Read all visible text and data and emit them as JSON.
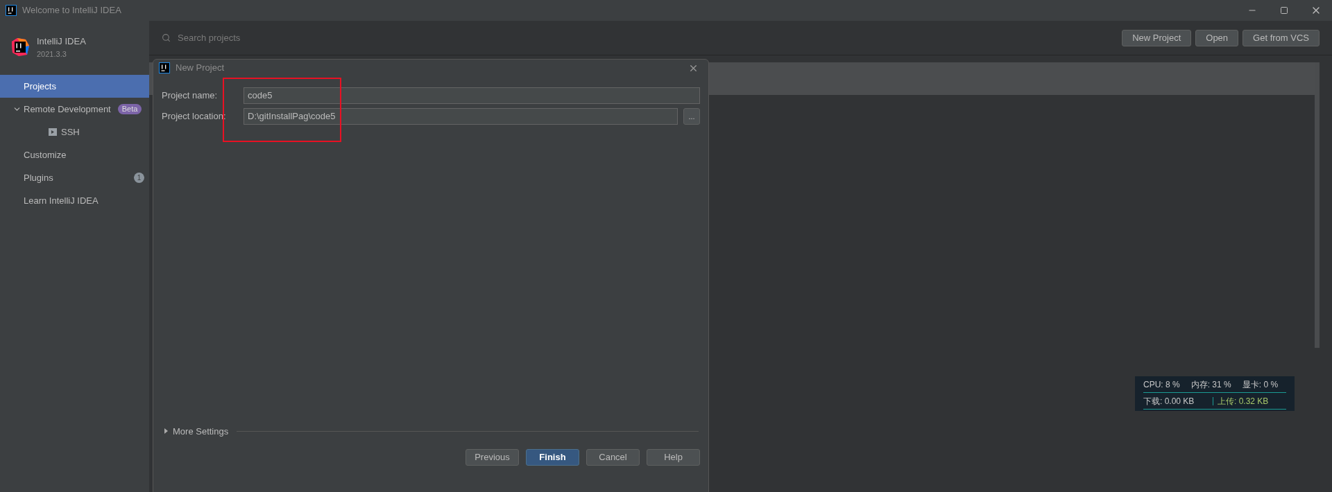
{
  "window": {
    "title": "Welcome to IntelliJ IDEA"
  },
  "sidebar": {
    "product": "IntelliJ IDEA",
    "version": "2021.3.3",
    "items": [
      {
        "label": "Projects",
        "selected": true
      },
      {
        "label": "Remote Development",
        "selected": false,
        "expanded": true,
        "badge": "Beta",
        "children": [
          {
            "label": "SSH",
            "selected": false
          }
        ]
      },
      {
        "label": "Customize",
        "selected": false
      },
      {
        "label": "Plugins",
        "selected": false,
        "count": "1"
      },
      {
        "label": "Learn IntelliJ IDEA",
        "selected": false
      }
    ]
  },
  "main": {
    "search": {
      "placeholder": "Search projects"
    },
    "buttons": [
      "New Project",
      "Open",
      "Get from VCS"
    ]
  },
  "dialog": {
    "title": "New Project",
    "fields": [
      {
        "label": "Project name:",
        "value": "code5"
      },
      {
        "label": "Project location:",
        "value": "D:\\gitInstallPag\\code5",
        "browse_label": "..."
      }
    ],
    "more_settings": {
      "label": "More Settings",
      "expanded": false
    },
    "buttons": [
      {
        "label": "Previous",
        "primary": false
      },
      {
        "label": "Finish",
        "primary": true
      },
      {
        "label": "Cancel",
        "primary": false
      },
      {
        "label": "Help",
        "primary": false
      }
    ]
  },
  "monitor": {
    "cpu": "CPU: 8 %",
    "memory": "内存: 31 %",
    "gpu": "显卡: 0 %",
    "download": "下载: 0.00 KB",
    "upload": "上传: 0.32 KB"
  }
}
